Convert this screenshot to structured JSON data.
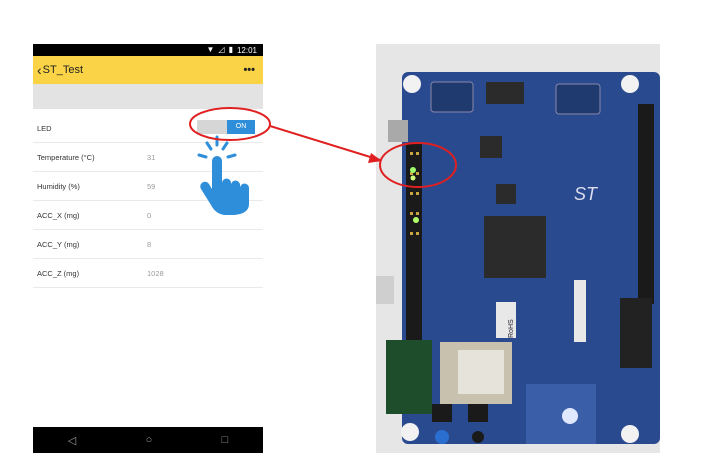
{
  "status_bar": {
    "time": "12:01",
    "wifi_icon": "wifi-icon",
    "signal_icon": "signal-icon",
    "battery_icon": "battery-icon"
  },
  "app_bar": {
    "back_glyph": "<",
    "title": "ST_Test",
    "overflow_glyph": "•••"
  },
  "rows": [
    {
      "label": "LED",
      "toggle": "ON"
    },
    {
      "label": "Temperature (°C)",
      "value": "31"
    },
    {
      "label": "Humidity (%)",
      "value": "59"
    },
    {
      "label": "ACC_X (mg)",
      "value": "0"
    },
    {
      "label": "ACC_Y (mg)",
      "value": "8"
    },
    {
      "label": "ACC_Z (mg)",
      "value": "1028"
    }
  ],
  "nav_bar": {
    "back": "◁",
    "home": "○",
    "recents": "□"
  },
  "colors": {
    "app_bar": "#fbd346",
    "toggle_on": "#2f8ed9",
    "annotation": "#e02020",
    "board": "#2a4a8f"
  },
  "board_labels": {
    "chip_label": "RoHS"
  }
}
